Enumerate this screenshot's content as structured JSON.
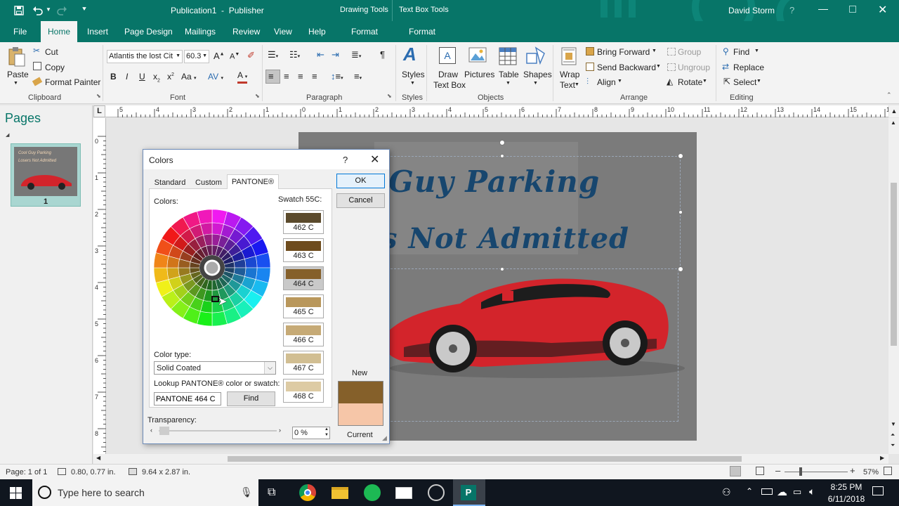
{
  "app": {
    "title": "Publication1  -  Publisher",
    "user": "David Storm",
    "context_tabs": [
      "Drawing Tools",
      "Text Box Tools"
    ]
  },
  "ribbon_tabs": [
    "File",
    "Home",
    "Insert",
    "Page Design",
    "Mailings",
    "Review",
    "View",
    "Help",
    "Format",
    "Format"
  ],
  "ribbon": {
    "clipboard": {
      "paste": "Paste",
      "cut": "Cut",
      "copy": "Copy",
      "format_painter": "Format Painter",
      "label": "Clipboard"
    },
    "font": {
      "font_name": "Atlantis the lost Cit",
      "font_size": "60.3",
      "label": "Font"
    },
    "paragraph": {
      "label": "Paragraph"
    },
    "styles": {
      "styles": "Styles",
      "label": "Styles"
    },
    "objects": {
      "draw_text_box_1": "Draw",
      "draw_text_box_2": "Text Box",
      "pictures": "Pictures",
      "table": "Table",
      "shapes": "Shapes",
      "label": "Objects"
    },
    "arrange": {
      "wrap_1": "Wrap",
      "wrap_2": "Text",
      "bring_forward": "Bring Forward",
      "send_backward": "Send Backward",
      "align": "Align",
      "group": "Group",
      "ungroup": "Ungroup",
      "rotate": "Rotate",
      "label": "Arrange"
    },
    "editing": {
      "find": "Find",
      "replace": "Replace",
      "select": "Select",
      "label": "Editing"
    }
  },
  "pages_pane": {
    "title": "Pages",
    "page_number": "1",
    "thumb_line1": "Cool Guy Parking",
    "thumb_line2": "Losers Not Admitted"
  },
  "document": {
    "line1": "Guy Parking",
    "line2": "s Not Admitted"
  },
  "ruler_h": [
    "5",
    "4",
    "3",
    "2",
    "1",
    "0",
    "1",
    "2",
    "3",
    "4",
    "5",
    "6",
    "7",
    "8",
    "9",
    "10",
    "11",
    "12",
    "13",
    "14",
    "15",
    "16"
  ],
  "ruler_v": [
    "0",
    "1",
    "2",
    "3",
    "4",
    "5",
    "6",
    "7",
    "8"
  ],
  "dialog": {
    "title": "Colors",
    "help": "?",
    "tabs": [
      "Standard",
      "Custom",
      "PANTONE®"
    ],
    "colors_label": "Colors:",
    "swatch_label": "Swatch 55C:",
    "swatches": [
      {
        "name": "462 C",
        "color": "#5b4a2c"
      },
      {
        "name": "463 C",
        "color": "#6e4c1e"
      },
      {
        "name": "464 C",
        "color": "#85602a"
      },
      {
        "name": "465 C",
        "color": "#b9975b"
      },
      {
        "name": "466 C",
        "color": "#c6aa76"
      },
      {
        "name": "467 C",
        "color": "#d1be92"
      },
      {
        "name": "468 C",
        "color": "#ddcba4"
      }
    ],
    "ok": "OK",
    "cancel": "Cancel",
    "color_type_label": "Color type:",
    "color_type_value": "Solid Coated",
    "lookup_label": "Lookup PANTONE® color or swatch:",
    "lookup_value": "PANTONE 464 C",
    "find": "Find",
    "transparency_label": "Transparency:",
    "transparency_value": "0 %",
    "new_label": "New",
    "current_label": "Current",
    "new_color": "#85602a",
    "current_color": "#f6c6a8"
  },
  "status": {
    "page": "Page: 1 of 1",
    "position": "0.80, 0.77 in.",
    "size": "9.64 x 2.87 in.",
    "zoom": "57%"
  },
  "taskbar": {
    "search_placeholder": "Type here to search",
    "time": "8:25 PM",
    "date": "6/11/2018"
  },
  "colors": {
    "accent": "#077568",
    "doc_text": "#17466e"
  }
}
